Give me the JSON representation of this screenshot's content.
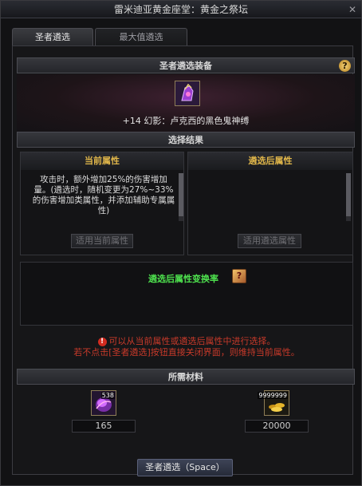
{
  "window": {
    "title": "雷米迪亚黄金座堂：黄金之祭坛",
    "close_glyph": "✕"
  },
  "tabs": [
    {
      "label": "圣者遴选",
      "active": true
    },
    {
      "label": "最大值遴选",
      "active": false
    }
  ],
  "equip_section": {
    "header": "圣者遴选装备",
    "help_glyph": "?",
    "item_name": "+14 幻影：卢克西的黑色鬼神缚",
    "item_icon": "phantom-gauntlet-icon"
  },
  "result_section": {
    "header": "选择结果",
    "current": {
      "title": "当前属性",
      "text": "攻击时，额外增加25%的伤害增加量。(遴选时，随机变更为27%~33%的伤害增加类属性，并添加辅助专属属性)",
      "button": "适用当前属性"
    },
    "after": {
      "title": "遴选后属性",
      "text": "",
      "button": "适用遴选属性"
    }
  },
  "rate": {
    "label": "遴选后属性变换率",
    "icon": "book-icon",
    "icon_glyph": "?"
  },
  "notice": {
    "line1": "可以从当前属性或遴选后属性中进行选择。",
    "line2": "若不点击[圣者遴选]按钮直接关闭界面，则维持当前属性。",
    "icon_glyph": "!"
  },
  "materials": {
    "header": "所需材料",
    "items": [
      {
        "icon": "purple-crystal-icon",
        "stack": "538",
        "value": "165"
      },
      {
        "icon": "gold-coins-icon",
        "stack": "9999999",
        "value": "20000"
      }
    ]
  },
  "actions": {
    "main_button": "圣者遴选（Space）"
  },
  "colors": {
    "accent_gold": "#e0b64a",
    "rate_green": "#4ee24e",
    "notice_red": "#c83a2a"
  }
}
